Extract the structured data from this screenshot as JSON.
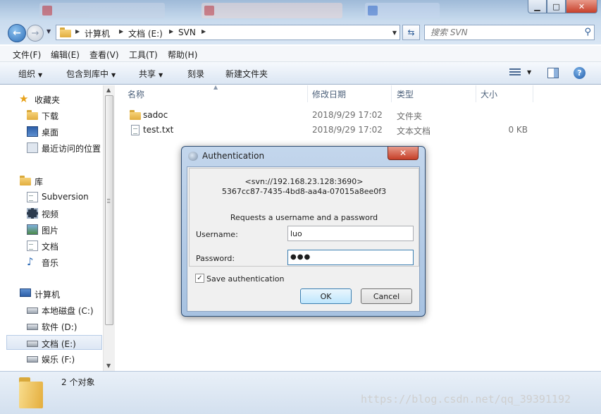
{
  "window": {
    "min": "▁",
    "max": "□",
    "close": "✕"
  },
  "address": {
    "crumbs": [
      "计算机",
      "文档 (E:)",
      "SVN"
    ],
    "search_placeholder": "搜索 SVN"
  },
  "menu": [
    "文件(F)",
    "编辑(E)",
    "查看(V)",
    "工具(T)",
    "帮助(H)"
  ],
  "toolbar": {
    "organize": "组织",
    "include_library": "包含到库中",
    "share": "共享",
    "burn": "刻录",
    "new_folder": "新建文件夹"
  },
  "nav": {
    "favorites": "收藏夹",
    "downloads": "下载",
    "desktop": "桌面",
    "recent": "最近访问的位置",
    "libraries": "库",
    "subversion": "Subversion",
    "videos": "视频",
    "pictures": "图片",
    "documents": "文档",
    "music": "音乐",
    "computer": "计算机",
    "drive_c": "本地磁盘 (C:)",
    "drive_d": "软件 (D:)",
    "drive_e": "文档 (E:)",
    "drive_f": "娱乐 (F:)"
  },
  "columns": {
    "name": "名称",
    "modified": "修改日期",
    "type": "类型",
    "size": "大小"
  },
  "files": [
    {
      "name": "sadoc",
      "modified": "2018/9/29 17:02",
      "type": "文件夹",
      "size": ""
    },
    {
      "name": "test.txt",
      "modified": "2018/9/29 17:02",
      "type": "文本文档",
      "size": "0 KB"
    }
  ],
  "status": {
    "count": "2 个对象",
    "watermark": "https://blog.csdn.net/qq_39391192"
  },
  "dialog": {
    "title": "Authentication",
    "close": "✕",
    "url": "<svn://192.168.23.128:3690>",
    "uuid": "5367cc87-7435-4bd8-aa4a-07015a8ee0f3",
    "message": "Requests a username and a password",
    "username_label": "Username:",
    "username_value": "luo",
    "password_label": "Password:",
    "password_value": "●●●",
    "save_auth": "Save authentication",
    "save_checked": "✓",
    "ok": "OK",
    "cancel": "Cancel"
  }
}
